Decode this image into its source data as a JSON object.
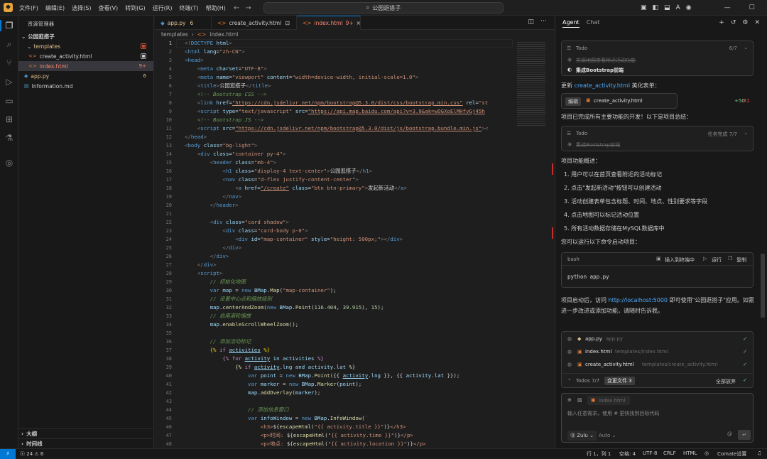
{
  "menu": [
    "文件(F)",
    "编辑(E)",
    "选择(S)",
    "查看(V)",
    "转到(G)",
    "运行(R)",
    "终端(T)",
    "帮助(H)"
  ],
  "command_center": "公园逛搭子",
  "sidebar": {
    "title": "资源管理器",
    "project": "公园逛搭子",
    "items": [
      {
        "label": "templates",
        "badge": "",
        "color": "#e2c08d"
      },
      {
        "label": "create_activity.html",
        "badge": "",
        "color": "#cccccc"
      },
      {
        "label": "index.html",
        "badge": "9+",
        "color": "#f48771"
      },
      {
        "label": "app.py",
        "badge": "6",
        "color": "#e2c08d"
      },
      {
        "label": "Information.md",
        "badge": "",
        "color": "#cccccc"
      }
    ],
    "outline": "大纲",
    "timeline": "时间线"
  },
  "tabs": [
    {
      "label": "app.py",
      "badge": "6"
    },
    {
      "label": "create_activity.html",
      "badge": ""
    },
    {
      "label": "index.html",
      "badge": "9+"
    }
  ],
  "breadcrumb": [
    "templates",
    "index.html"
  ],
  "editor": {
    "line_numbers": [
      1,
      2,
      3,
      4,
      5,
      6,
      7,
      8,
      9,
      10,
      11,
      12,
      13,
      14,
      15,
      16,
      17,
      18,
      19,
      20,
      21,
      22,
      23,
      24,
      25,
      26,
      27,
      28,
      29,
      30,
      31,
      32,
      33,
      34,
      35,
      36,
      37,
      38,
      39,
      40,
      41,
      42,
      43,
      44,
      45,
      46,
      47,
      48
    ]
  },
  "agent": {
    "tabs": [
      "Agent",
      "Chat"
    ],
    "todo1": {
      "title": "Todo",
      "count": "6/7",
      "item1": "实现地图查看附近活动功能",
      "item2": "集成Bootstrap前端"
    },
    "update_prefix": "更新",
    "update_link": "create_activity.html",
    "update_suffix": "美化表单：",
    "edit_label": "编辑",
    "edit_file": "create_activity.html",
    "edit_plus": "+50",
    "edit_minus": "-31",
    "done_text": "项目已完成所有主要功能的开发！以下是项目总结：",
    "todo2": {
      "title": "Todo",
      "status": "任务完成 7/7",
      "item": "集成Bootstrap前端"
    },
    "overview_title": "项目功能概述：",
    "overview": [
      "1. 用户可以在首页查看附近的活动标记",
      "2. 点击\"发起新活动\"按钮可以创建活动",
      "3. 活动创建表单包含标题、时间、地点、性别要求等字段",
      "4. 点击地图可以标记活动位置",
      "5. 所有活动数据存储在MySQL数据库中"
    ],
    "run_text": "您可以运行以下命令启动项目：",
    "code_lang": "bash",
    "code_actions": [
      "插入到终端中",
      "运行",
      "复制"
    ],
    "code": "python app.py",
    "after_prefix": "项目启动后，访问",
    "after_link": "http://localhost:5000",
    "after_suffix": "即可使用\"公园逛搭子\"应用。如需",
    "after_line2": "进一步改进或添加功能，请随时告诉我。",
    "files": [
      {
        "name": "app.py",
        "path": "app.py"
      },
      {
        "name": "index.html",
        "path": "templates/index.html"
      },
      {
        "name": "create_activity.html",
        "path": "templates/create_activity.html"
      }
    ],
    "todos_footer": "Todos 7/7",
    "changed_files": "变更文件 3",
    "discard_all": "全部放弃",
    "context_file": "index.html",
    "input_placeholder": "输入任意需求，使用 # 更快找到目标代码",
    "model": "Zulu",
    "mode": "Auto"
  },
  "status": {
    "errors": "24",
    "warnings": "6",
    "position": "行 1，列 1",
    "spaces": "空格: 4",
    "encoding": "UTF-8",
    "eol": "CRLF",
    "language": "HTML",
    "settings": "Comate设置"
  }
}
